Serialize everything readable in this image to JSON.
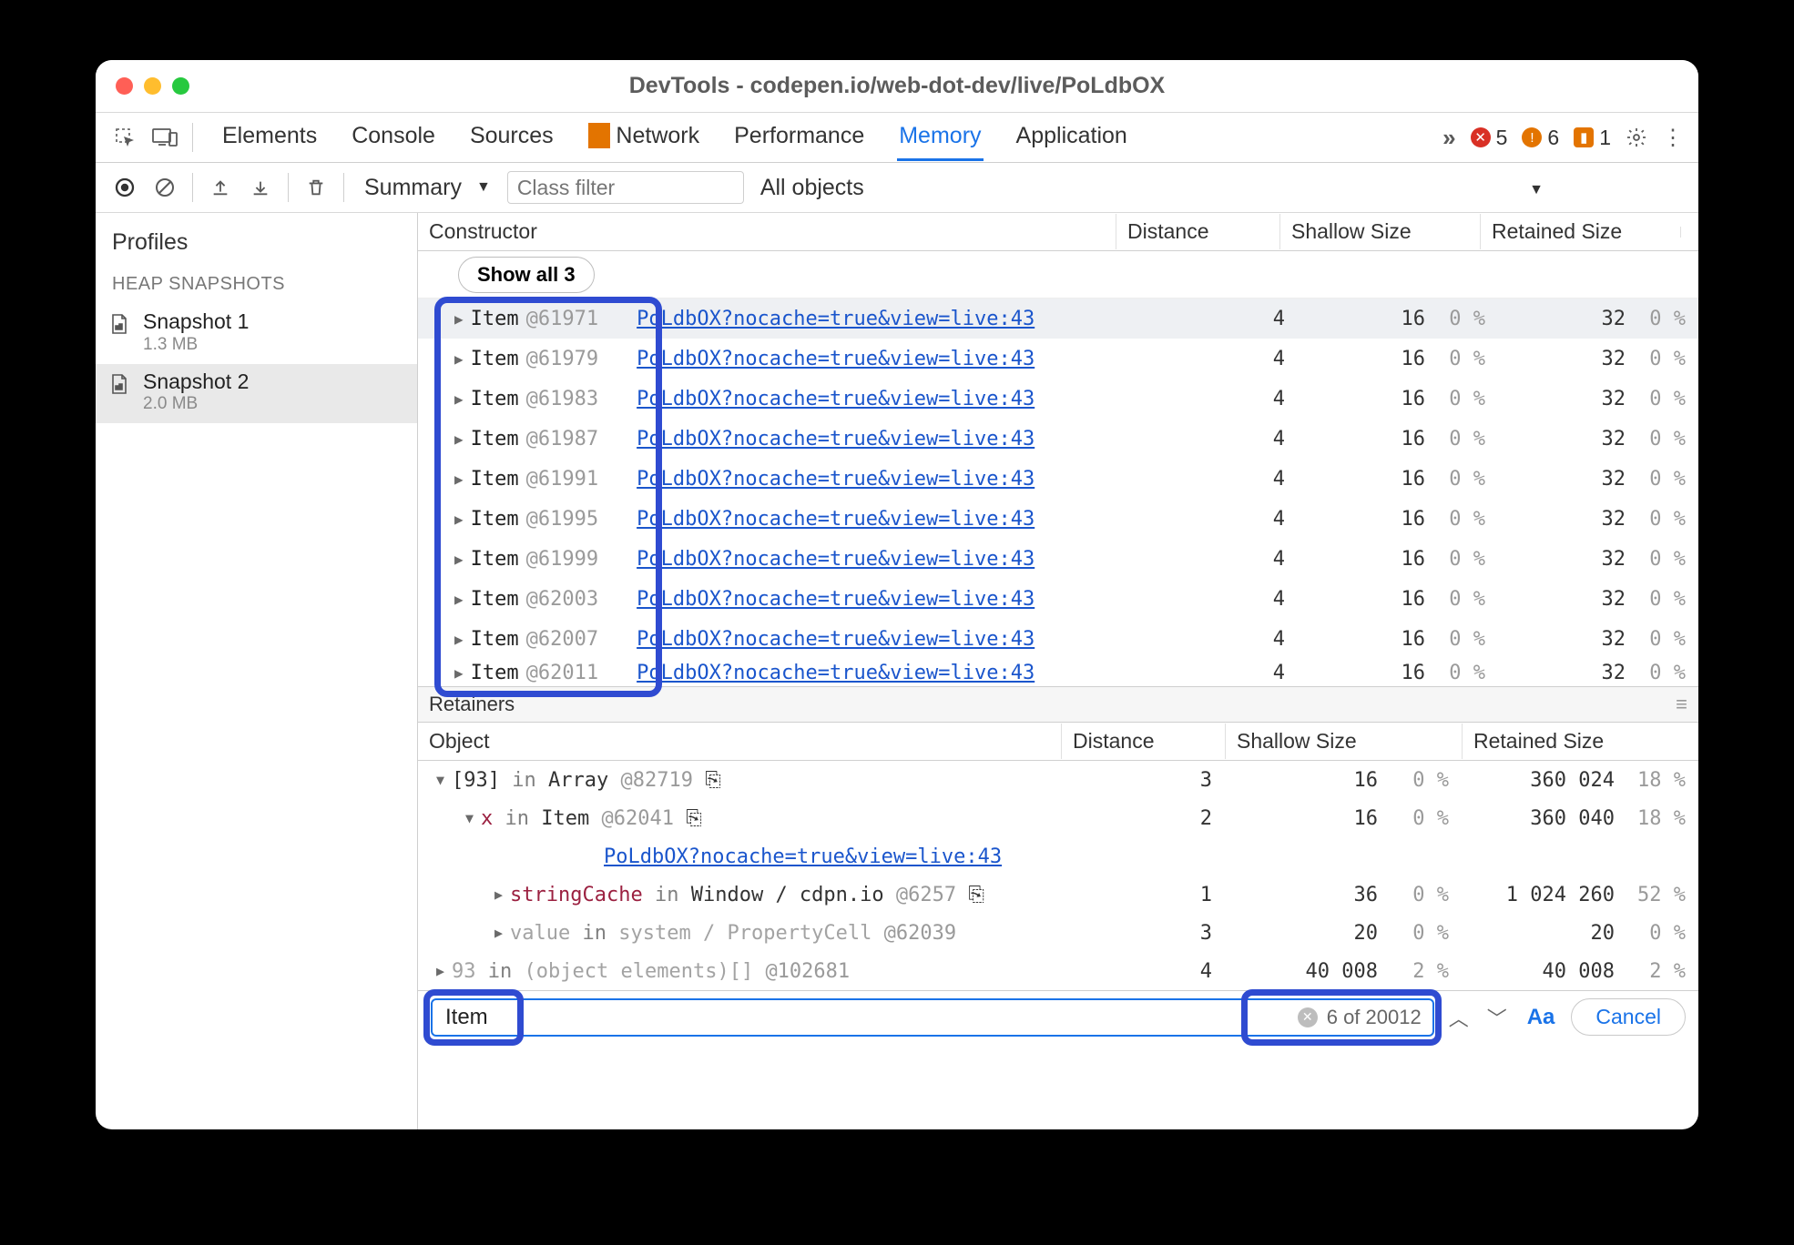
{
  "window": {
    "title": "DevTools - codepen.io/web-dot-dev/live/PoLdbOX"
  },
  "tabs": {
    "items": [
      "Elements",
      "Console",
      "Sources",
      "Network",
      "Performance",
      "Memory",
      "Application"
    ],
    "active": "Memory",
    "warn_on": "Network"
  },
  "status": {
    "errors": "5",
    "warnings": "6",
    "issues": "1"
  },
  "subbar": {
    "summary_label": "Summary",
    "filter_placeholder": "Class filter",
    "all_label": "All objects"
  },
  "sidebar": {
    "title": "Profiles",
    "section": "HEAP SNAPSHOTS",
    "snapshots": [
      {
        "name": "Snapshot 1",
        "size": "1.3 MB",
        "selected": false
      },
      {
        "name": "Snapshot 2",
        "size": "2.0 MB",
        "selected": true
      }
    ]
  },
  "columns": {
    "c1": "Constructor",
    "c2": "Distance",
    "c3": "Shallow Size",
    "c4": "Retained Size"
  },
  "show_all": "Show all 3",
  "link_text": "PoLdbOX?nocache=true&view=live:43",
  "rows": [
    {
      "name": "Item",
      "id": "@61971",
      "dist": "4",
      "shal": "16",
      "shal_pct": "0 %",
      "ret": "32",
      "ret_pct": "0 %",
      "sel": true
    },
    {
      "name": "Item",
      "id": "@61979",
      "dist": "4",
      "shal": "16",
      "shal_pct": "0 %",
      "ret": "32",
      "ret_pct": "0 %",
      "sel": false
    },
    {
      "name": "Item",
      "id": "@61983",
      "dist": "4",
      "shal": "16",
      "shal_pct": "0 %",
      "ret": "32",
      "ret_pct": "0 %",
      "sel": false
    },
    {
      "name": "Item",
      "id": "@61987",
      "dist": "4",
      "shal": "16",
      "shal_pct": "0 %",
      "ret": "32",
      "ret_pct": "0 %",
      "sel": false
    },
    {
      "name": "Item",
      "id": "@61991",
      "dist": "4",
      "shal": "16",
      "shal_pct": "0 %",
      "ret": "32",
      "ret_pct": "0 %",
      "sel": false
    },
    {
      "name": "Item",
      "id": "@61995",
      "dist": "4",
      "shal": "16",
      "shal_pct": "0 %",
      "ret": "32",
      "ret_pct": "0 %",
      "sel": false
    },
    {
      "name": "Item",
      "id": "@61999",
      "dist": "4",
      "shal": "16",
      "shal_pct": "0 %",
      "ret": "32",
      "ret_pct": "0 %",
      "sel": false
    },
    {
      "name": "Item",
      "id": "@62003",
      "dist": "4",
      "shal": "16",
      "shal_pct": "0 %",
      "ret": "32",
      "ret_pct": "0 %",
      "sel": false
    },
    {
      "name": "Item",
      "id": "@62007",
      "dist": "4",
      "shal": "16",
      "shal_pct": "0 %",
      "ret": "32",
      "ret_pct": "0 %",
      "sel": false
    },
    {
      "name": "Item",
      "id": "@62011",
      "dist": "4",
      "shal": "16",
      "shal_pct": "0 %",
      "ret": "32",
      "ret_pct": "0 %",
      "sel": false
    }
  ],
  "retainers": {
    "title": "Retainers",
    "columns": {
      "c1": "Object",
      "c2": "Distance",
      "c3": "Shallow Size",
      "c4": "Retained Size"
    },
    "rows": [
      {
        "kind": "root",
        "open": true,
        "ind": 0,
        "html": "[93] :kw:in:/kw: Array :id:@82719 ⎘",
        "dist": "3",
        "shal": "16",
        "shal_pct": "0 %",
        "ret": "360 024",
        "ret_pct": "18 %"
      },
      {
        "kind": "child",
        "open": true,
        "ind": 1,
        "html": ":prop:x:/prop: :kw:in:/kw: Item :id:@62041 ⎘",
        "dist": "2",
        "shal": "16",
        "shal_pct": "0 %",
        "ret": "360 040",
        "ret_pct": "18 %"
      },
      {
        "kind": "link",
        "ind": 2,
        "link": "PoLdbOX?nocache=true&view=live:43"
      },
      {
        "kind": "child",
        "open": false,
        "ind": 2,
        "html": ":prop:stringCache:/prop: :kw:in:/kw: Window / cdpn.io :id:@6257 ⎘",
        "dist": "1",
        "shal": "36",
        "shal_pct": "0 %",
        "ret": "1 024 260",
        "ret_pct": "52 %"
      },
      {
        "kind": "child",
        "open": false,
        "ind": 2,
        "muted": true,
        "html": "value :kw:in:/kw: system / PropertyCell :id:@62039",
        "dist": "3",
        "shal": "20",
        "shal_pct": "0 %",
        "ret": "20",
        "ret_pct": "0 %"
      },
      {
        "kind": "root",
        "open": false,
        "ind": 0,
        "muted": true,
        "html": "93 :kw:in:/kw: (object elements)[] :id:@102681",
        "dist": "4",
        "shal": "40 008",
        "shal_pct": "2 %",
        "ret": "40 008",
        "ret_pct": "2 %"
      }
    ]
  },
  "search": {
    "value": "Item",
    "count": "6 of 20012",
    "aa": "Aa",
    "cancel": "Cancel"
  }
}
